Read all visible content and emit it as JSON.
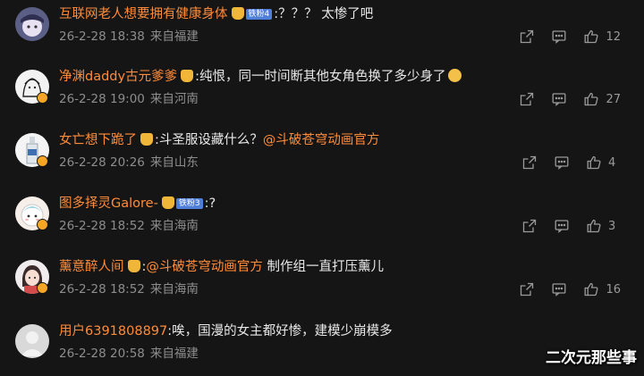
{
  "comments": [
    {
      "username": "互联网老人想要拥有健康身体",
      "fan_badge": "铁粉4",
      "text": ":？？？ 太惨了吧",
      "date": "26-2-28 18:38",
      "location": "来自福建",
      "likes": "12"
    },
    {
      "username": "净渊daddy古元爹爹",
      "text": ":纯恨，同一时间断其他女角色换了多少身了",
      "date": "26-2-28 19:00",
      "location": "来自河南",
      "likes": "27"
    },
    {
      "username": "女亡想下跪了",
      "text_before": ":斗圣服设藏什么？",
      "mention": "@斗破苍穹动画官方",
      "date": "26-2-28 20:26",
      "location": "来自山东",
      "likes": "4"
    },
    {
      "username": "图多择灵Galore-",
      "fan_badge": "铁粉3",
      "text": ":?",
      "date": "26-2-28 18:52",
      "location": "来自海南",
      "likes": "3"
    },
    {
      "username": "薰意醉人间",
      "text_before": ":",
      "mention": "@斗破苍穹动画官方",
      "text_after": " 制作组一直打压薰儿",
      "date": "26-2-28 18:52",
      "location": "来自海南",
      "likes": "16"
    },
    {
      "username": "用户6391808897",
      "text": ":唉，国漫的女主都好惨，建模少崩模多",
      "date": "26-2-28 20:58",
      "location": "来自福建",
      "likes": ""
    }
  ],
  "watermark": "二次元那些事",
  "icons": {
    "share": "share-icon",
    "reply": "comment-icon",
    "like": "thumbs-up-icon"
  },
  "colors": {
    "background": "#151515",
    "username": "#ff8c3a",
    "text": "#e9e9e9",
    "meta": "#8d8d8d"
  }
}
